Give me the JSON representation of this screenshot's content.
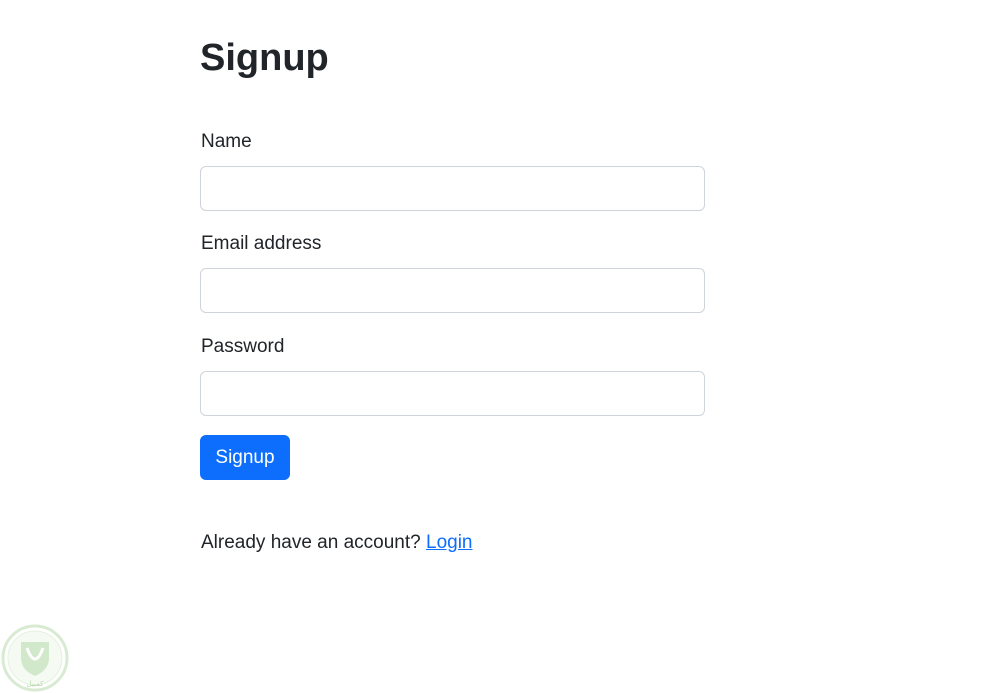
{
  "form": {
    "title": "Signup",
    "name_label": "Name",
    "name_value": "",
    "email_label": "Email address",
    "email_value": "",
    "password_label": "Password",
    "password_value": "",
    "submit_label": "Signup"
  },
  "footer": {
    "prompt": "Already have an account?",
    "login_link": "Login"
  },
  "watermark": {
    "icon": "shield-icon",
    "text": "كمبيل"
  },
  "colors": {
    "primary": "#0d6efd",
    "text": "#212529",
    "input_border": "#ced4da",
    "watermark_green": "#7dbb6a"
  }
}
